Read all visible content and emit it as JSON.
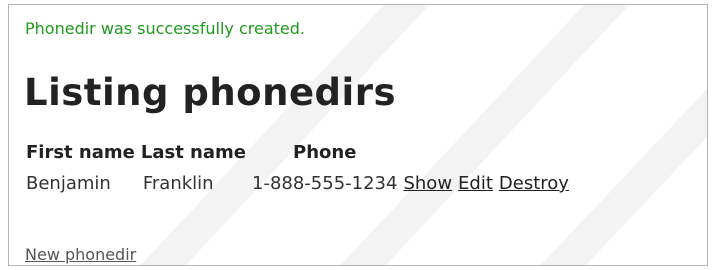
{
  "notice": "Phonedir was successfully created.",
  "title": "Listing phonedirs",
  "table": {
    "headers": [
      "First name",
      "Last name",
      "Phone"
    ],
    "rows": [
      {
        "first_name": "Benjamin",
        "last_name": "Franklin",
        "phone": "1-888-555-1234",
        "actions": [
          "Show",
          "Edit",
          "Destroy"
        ]
      }
    ]
  },
  "new_link": "New phonedir"
}
